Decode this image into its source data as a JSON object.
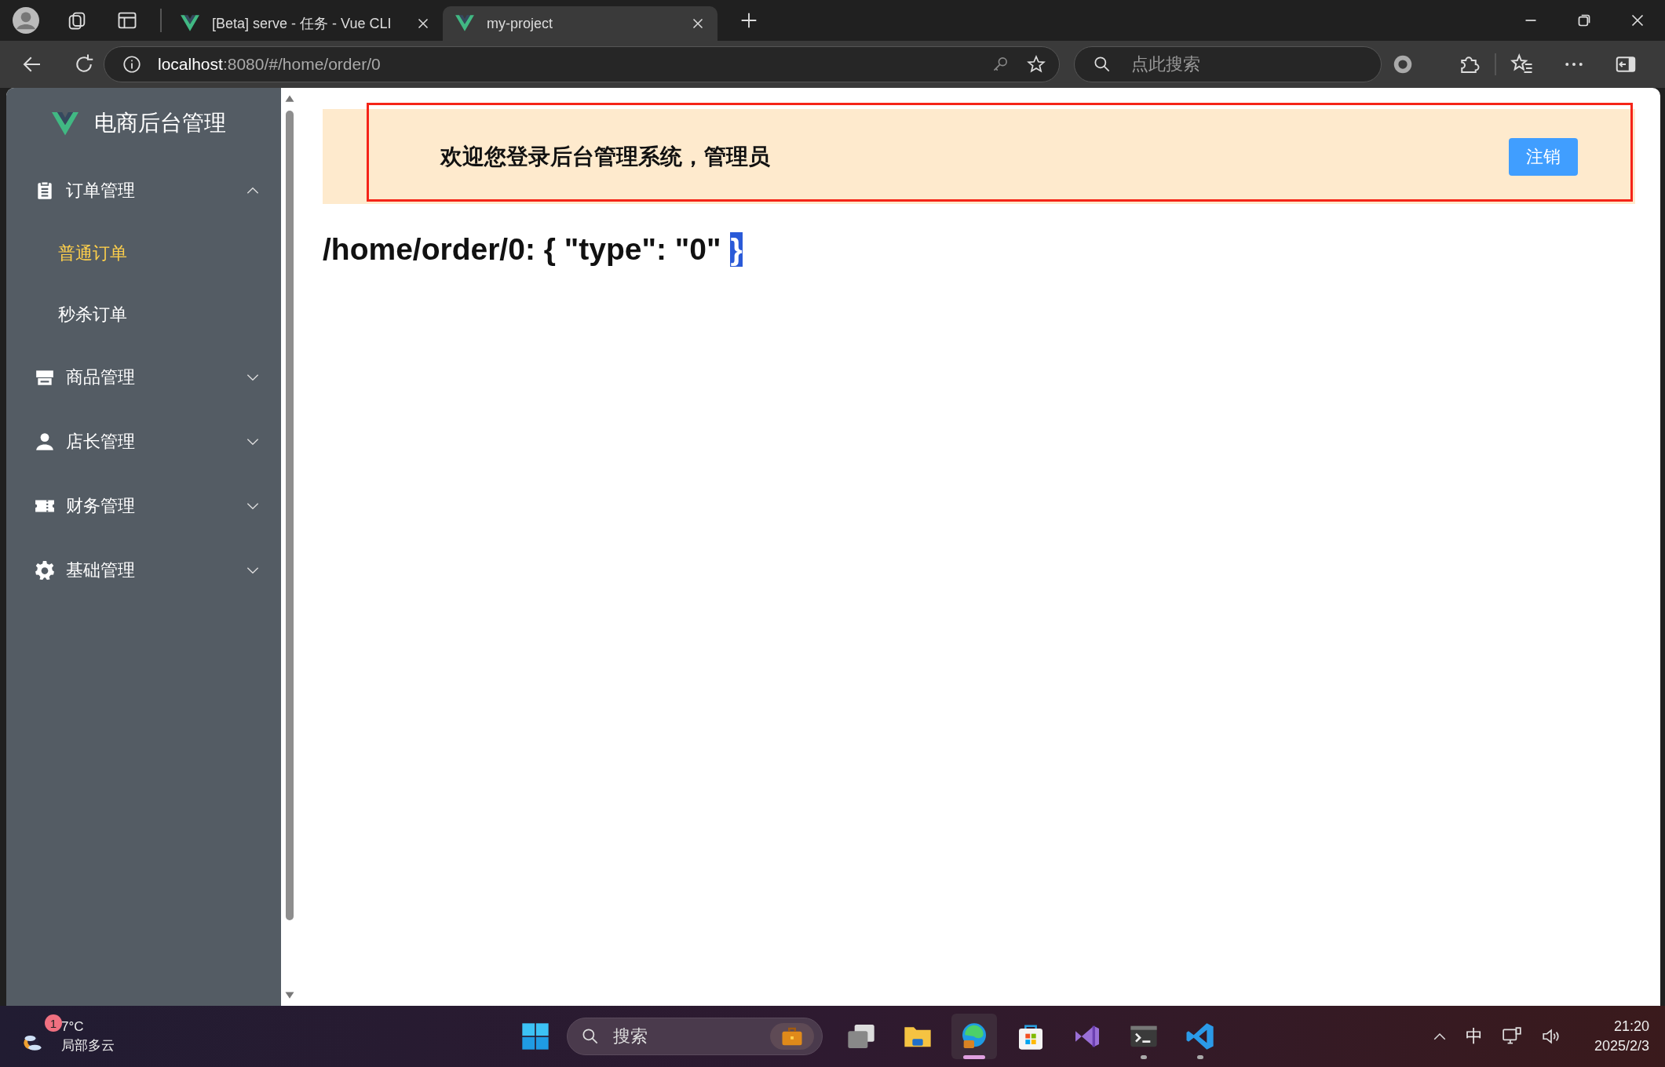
{
  "browser": {
    "tabs": [
      {
        "title": "[Beta] serve - 任务 - Vue CLI",
        "selected": false
      },
      {
        "title": "my-project",
        "selected": true
      }
    ],
    "address": {
      "host": "localhost",
      "rest": ":8080/#/home/order/0"
    },
    "search": {
      "placeholder": "点此搜索"
    }
  },
  "sidebar": {
    "title": "电商后台管理",
    "menu": [
      {
        "label": "订单管理",
        "expanded": true,
        "children": [
          {
            "label": "普通订单",
            "selected": true
          },
          {
            "label": "秒杀订单",
            "selected": false
          }
        ]
      },
      {
        "label": "商品管理",
        "expanded": false
      },
      {
        "label": "店长管理",
        "expanded": false
      },
      {
        "label": "财务管理",
        "expanded": false
      },
      {
        "label": "基础管理",
        "expanded": false
      }
    ]
  },
  "header": {
    "welcome": "欢迎您登录后台管理系统，管理员",
    "logout_button": "注销"
  },
  "route": {
    "text": "/home/order/0: { \"type\": \"0\"",
    "selected_text": "}"
  },
  "taskbar": {
    "weather": {
      "badge": "1",
      "temperature": "7°C",
      "condition": "局部多云"
    },
    "search": {
      "placeholder": "搜索"
    },
    "apps": [
      {
        "kind": "taskview",
        "running": false,
        "active": false
      },
      {
        "kind": "files",
        "running": false,
        "active": false
      },
      {
        "kind": "edge",
        "running": true,
        "active": true
      },
      {
        "kind": "store",
        "running": false,
        "active": false
      },
      {
        "kind": "vs",
        "running": false,
        "active": false
      },
      {
        "kind": "terminal",
        "running": true,
        "active": false
      },
      {
        "kind": "vscode",
        "running": true,
        "active": false
      }
    ],
    "ime": "中",
    "time": "21:20",
    "date": "2025/2/3"
  }
}
